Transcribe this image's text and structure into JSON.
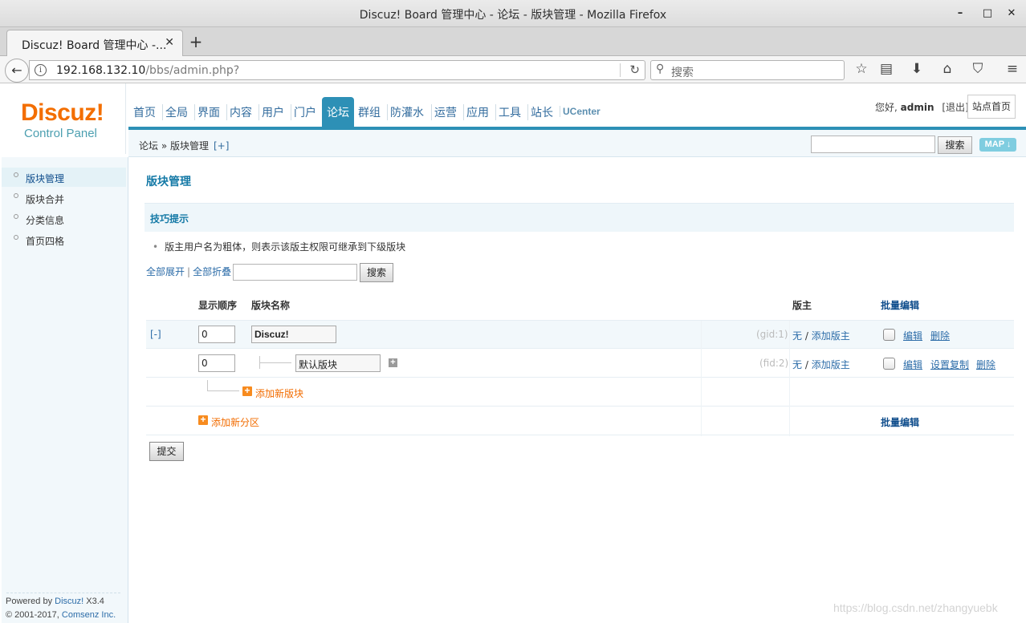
{
  "window": {
    "title": "Discuz! Board 管理中心 - 论坛 - 版块管理 - Mozilla Firefox",
    "min_icon": "minimize-icon",
    "max_icon": "maximize-icon",
    "close_icon": "close-icon"
  },
  "browser": {
    "tab_label": "Discuz! Board 管理中心 -...",
    "url_host": "192.168.132.10",
    "url_path": "/bbs/admin.php?",
    "search_placeholder": "搜索"
  },
  "header": {
    "logo": "Discuz!",
    "logo_sub": "Control Panel",
    "nav": [
      "首页",
      "全局",
      "界面",
      "内容",
      "用户",
      "门户",
      "论坛",
      "群组",
      "防灌水",
      "运营",
      "应用",
      "工具",
      "站长",
      "UCenter"
    ],
    "active_nav": "论坛",
    "greeting": "您好,",
    "username": "admin",
    "logout": "[退出]",
    "site_home": "站点首页"
  },
  "subbar": {
    "crumb": "论坛 » 版块管理",
    "crumb_plus": "[+]",
    "search_button": "搜索",
    "map_button": "MAP"
  },
  "sidebar": {
    "items": [
      {
        "label": "版块管理",
        "active": true
      },
      {
        "label": "版块合并",
        "active": false
      },
      {
        "label": "分类信息",
        "active": false
      },
      {
        "label": "首页四格",
        "active": false
      }
    ],
    "powered_prefix": "Powered by",
    "powered_brand": "Discuz!",
    "powered_version": "X3.4",
    "copyright_prefix": "© 2001-2017,",
    "copyright_brand": "Comsenz Inc."
  },
  "main": {
    "page_title": "版块管理",
    "tips_title": "技巧提示",
    "tip": "版主用户名为粗体，则表示该版主权限可继承到下级版块",
    "expand_all": "全部展开",
    "collapse_all": "全部折叠",
    "search_button": "搜索",
    "columns": {
      "order": "显示顺序",
      "name": "版块名称",
      "moderator": "版主",
      "batch_edit": "批量编辑"
    },
    "rows": [
      {
        "toggle": "[-]",
        "order": "0",
        "name": "Discuz!",
        "id": "(gid:1)",
        "mod_none": "无",
        "mod_sep": " / ",
        "mod_add": "添加版主",
        "actions": [
          "编辑",
          "删除"
        ]
      },
      {
        "order": "0",
        "name": "默认版块",
        "id": "(fid:2)",
        "mod_none": "无",
        "mod_sep": " / ",
        "mod_add": "添加版主",
        "actions": [
          "编辑",
          "设置复制",
          "删除"
        ]
      }
    ],
    "add_forum": "添加新版块",
    "add_group": "添加新分区",
    "batch_edit_bottom": "批量编辑",
    "submit": "提交"
  },
  "watermark": "https://blog.csdn.net/zhangyuebk"
}
